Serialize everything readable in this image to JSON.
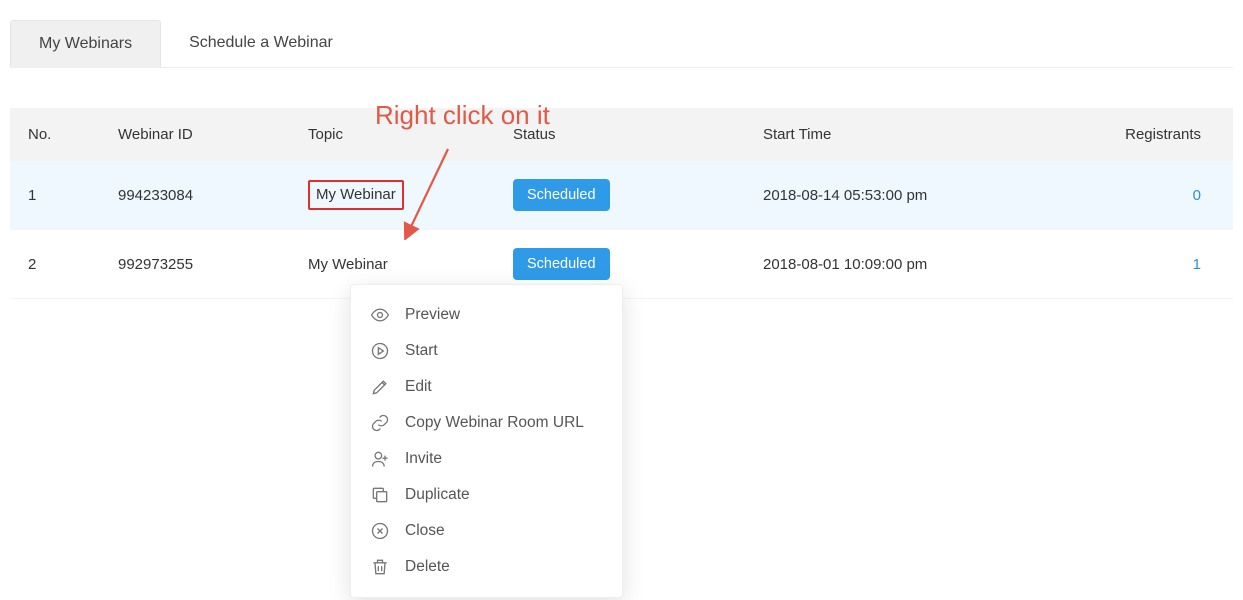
{
  "tabs": {
    "my_webinars": "My Webinars",
    "schedule": "Schedule a Webinar"
  },
  "annotation_text": "Right click on it",
  "table": {
    "headers": {
      "no": "No.",
      "webinar_id": "Webinar ID",
      "topic": "Topic",
      "status": "Status",
      "start_time": "Start Time",
      "registrants": "Registrants"
    },
    "rows": [
      {
        "no": "1",
        "id": "994233084",
        "topic": "My Webinar",
        "status": "Scheduled",
        "start_time": "2018-08-14 05:53:00 pm",
        "registrants": "0",
        "highlighted": true
      },
      {
        "no": "2",
        "id": "992973255",
        "topic": "My Webinar",
        "status": "Scheduled",
        "start_time": "2018-08-01 10:09:00 pm",
        "registrants": "1",
        "highlighted": false
      }
    ]
  },
  "context_menu": {
    "preview": "Preview",
    "start": "Start",
    "edit": "Edit",
    "copy_url": "Copy Webinar Room URL",
    "invite": "Invite",
    "duplicate": "Duplicate",
    "close": "Close",
    "delete": "Delete"
  }
}
